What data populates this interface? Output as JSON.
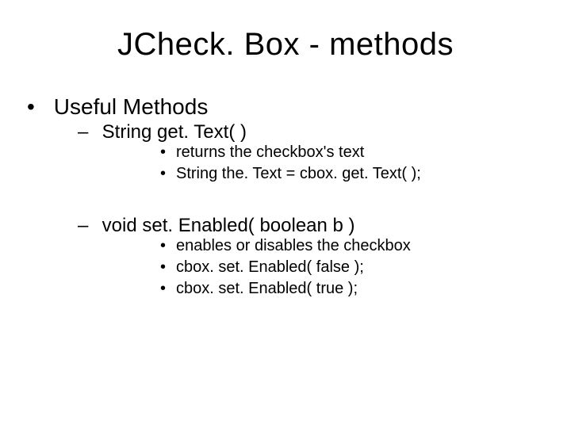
{
  "title": "JCheck. Box - methods",
  "level1": {
    "item0": "Useful Methods"
  },
  "level2": {
    "methodA": "String get. Text( )",
    "methodB": "void set. Enabled( boolean b )"
  },
  "level3": {
    "a0": "returns the checkbox's text",
    "a1": "String the. Text = cbox. get. Text( );",
    "b0": "enables or disables the checkbox",
    "b1": "cbox. set. Enabled( false );",
    "b2": "cbox. set. Enabled( true );"
  }
}
